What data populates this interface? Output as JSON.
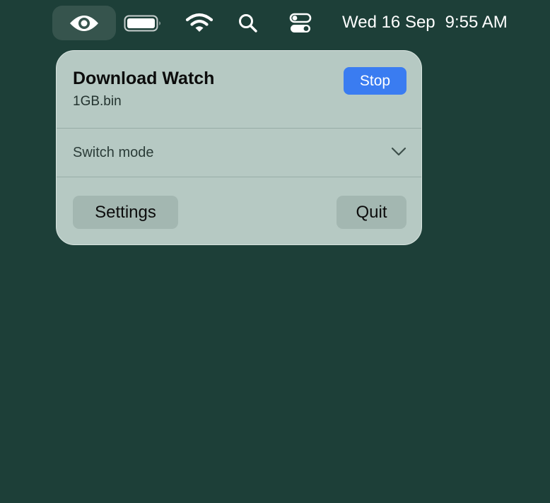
{
  "menubar": {
    "icons": {
      "app": "eye-icon",
      "battery": "battery-icon",
      "wifi": "wifi-icon",
      "search": "search-icon",
      "control_center": "control-center-icon"
    },
    "date": "Wed 16 Sep",
    "time": "9:55 AM"
  },
  "popover": {
    "title": "Download Watch",
    "file": "1GB.bin",
    "stop_label": "Stop",
    "mode_label": "Switch mode",
    "mode_icon": "chevron-down-icon",
    "settings_label": "Settings",
    "quit_label": "Quit"
  },
  "colors": {
    "desktop": "#1d3f38",
    "popover_bg": "#b6c9c3",
    "accent": "#3a7cf1",
    "secondary_button": "#a3b7b1"
  }
}
